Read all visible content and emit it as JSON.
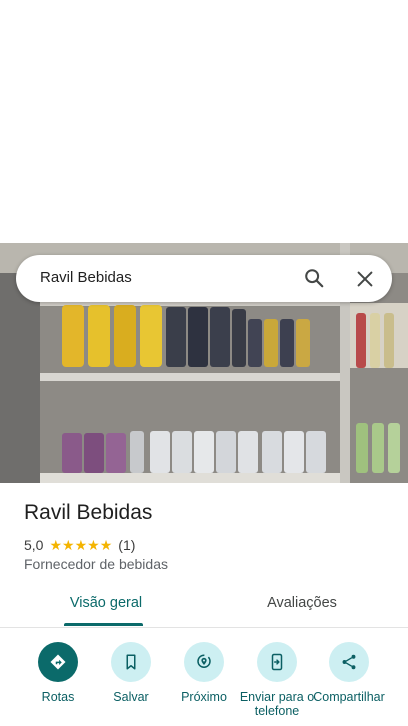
{
  "search": {
    "query": "Ravil Bebidas"
  },
  "place": {
    "title": "Ravil Bebidas",
    "rating": "5,0",
    "stars": 5,
    "review_count": "(1)",
    "category": "Fornecedor de bebidas"
  },
  "tabs": [
    {
      "label": "Visão geral",
      "selected": true
    },
    {
      "label": "Avaliações",
      "selected": false
    }
  ],
  "actions": [
    {
      "label": "Rotas",
      "icon": "directions-icon"
    },
    {
      "label": "Salvar",
      "icon": "bookmark-icon"
    },
    {
      "label": "Próximo",
      "icon": "nearby-icon"
    },
    {
      "label": "Enviar para o telefone",
      "icon": "send-to-phone-icon"
    },
    {
      "label": "Compartilhar",
      "icon": "share-icon"
    }
  ],
  "colors": {
    "accent": "#0b6a6a",
    "action_bg": "#cdeff2",
    "star": "#f4b400"
  }
}
